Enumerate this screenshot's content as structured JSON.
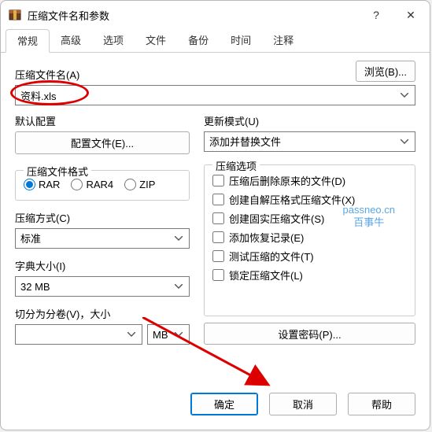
{
  "window": {
    "title": "压缩文件名和参数"
  },
  "tabs": [
    "常规",
    "高级",
    "选项",
    "文件",
    "备份",
    "时间",
    "注释"
  ],
  "active_tab": 0,
  "browse_btn": "浏览(B)...",
  "filename": {
    "label": "压缩文件名(A)",
    "value": "资料.xls"
  },
  "default_profile": {
    "label": "默认配置",
    "button": "配置文件(E)..."
  },
  "update_mode": {
    "label": "更新模式(U)",
    "value": "添加并替换文件"
  },
  "format": {
    "legend": "压缩文件格式",
    "options": [
      "RAR",
      "RAR4",
      "ZIP"
    ],
    "selected": "RAR"
  },
  "method": {
    "label": "压缩方式(C)",
    "value": "标准"
  },
  "dict": {
    "label": "字典大小(I)",
    "value": "32 MB"
  },
  "split": {
    "label": "切分为分卷(V)，大小",
    "value": "",
    "unit": "MB"
  },
  "options": {
    "legend": "压缩选项",
    "items": [
      "压缩后删除原来的文件(D)",
      "创建自解压格式压缩文件(X)",
      "创建固实压缩文件(S)",
      "添加恢复记录(E)",
      "测试压缩的文件(T)",
      "锁定压缩文件(L)"
    ]
  },
  "password_btn": "设置密码(P)...",
  "footer": {
    "ok": "确定",
    "cancel": "取消",
    "help": "帮助"
  },
  "watermark": {
    "line1": "passneo.cn",
    "line2": "百事牛"
  }
}
